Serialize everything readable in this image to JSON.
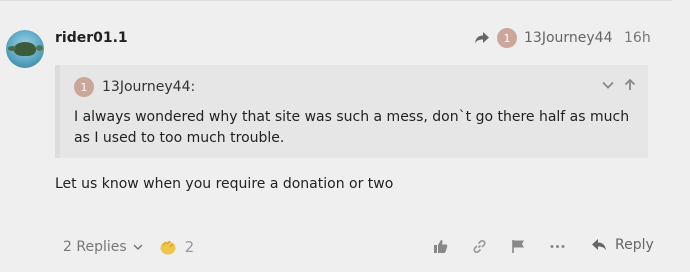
{
  "post": {
    "username": "rider01.1",
    "reply_to_user": "13Journey44",
    "reply_to_badge": "1",
    "time": "16h",
    "quote": {
      "badge": "1",
      "author": "13Journey44:",
      "text": "I always wondered why that site was such a mess, don`t go there half as much as I used to too much trouble."
    },
    "body": "Let us know when you require a donation or two",
    "actions": {
      "replies_label": "2 Replies",
      "reaction_count": "2",
      "reply_label": "Reply"
    }
  },
  "colors": {
    "background": "#efefef",
    "quote_bg": "#e6e6e6",
    "badge": "#caa79a"
  },
  "icons": [
    "share-arrow-icon",
    "chevron-down-icon",
    "arrow-up-icon",
    "clap-icon",
    "like-icon",
    "link-icon",
    "flag-icon",
    "more-icon",
    "reply-icon"
  ]
}
